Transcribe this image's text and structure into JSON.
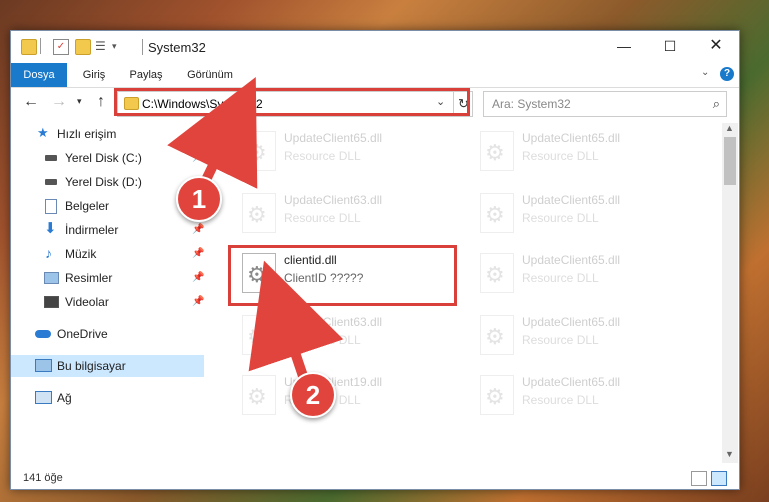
{
  "window": {
    "title": "System32"
  },
  "ribbon": {
    "tabs": [
      "Dosya",
      "Giriş",
      "Paylaş",
      "Görünüm"
    ]
  },
  "address": {
    "path": "C:\\Windows\\System32",
    "search_placeholder": "Ara: System32"
  },
  "sidebar": {
    "items": [
      {
        "label": "Hızlı erişim",
        "icon": "star-icon"
      },
      {
        "label": "Yerel Disk (C:)",
        "icon": "drive-icon",
        "pinned": true
      },
      {
        "label": "Yerel Disk (D:)",
        "icon": "drive-icon"
      },
      {
        "label": "Belgeler",
        "icon": "documents-icon",
        "pinned": true
      },
      {
        "label": "İndirmeler",
        "icon": "downloads-icon",
        "pinned": true
      },
      {
        "label": "Müzik",
        "icon": "music-icon",
        "pinned": true
      },
      {
        "label": "Resimler",
        "icon": "pictures-icon",
        "pinned": true
      },
      {
        "label": "Videolar",
        "icon": "videos-icon",
        "pinned": true
      },
      {
        "label": "OneDrive",
        "icon": "cloud-icon"
      },
      {
        "label": "Bu bilgisayar",
        "icon": "computer-icon",
        "selected": true
      },
      {
        "label": "Ağ",
        "icon": "network-icon"
      }
    ]
  },
  "files": {
    "left": [
      {
        "name": "UpdateClient65.dll",
        "desc": "Resource DLL"
      },
      {
        "name": "UpdateClient63.dll",
        "desc": "Resource DLL"
      },
      {
        "name": "clientid.dll",
        "desc": "ClientID ?????"
      },
      {
        "name": "UpdateClient63.dll",
        "desc": "Resource DLL"
      },
      {
        "name": "UpdateClient19.dll",
        "desc": "Resource DLL"
      }
    ],
    "right": [
      {
        "name": "UpdateClient65.dll",
        "desc": "Resource DLL"
      },
      {
        "name": "UpdateClient65.dll",
        "desc": "Resource DLL"
      },
      {
        "name": "UpdateClient65.dll",
        "desc": "Resource DLL"
      },
      {
        "name": "UpdateClient65.dll",
        "desc": "Resource DLL"
      },
      {
        "name": "UpdateClient65.dll",
        "desc": "Resource DLL"
      }
    ]
  },
  "status": {
    "item_count": "141 öğe"
  },
  "callouts": [
    "1",
    "2"
  ],
  "colors": {
    "accent": "#1979ca",
    "highlight": "#d9403a",
    "selected_bg": "#cce8ff"
  }
}
